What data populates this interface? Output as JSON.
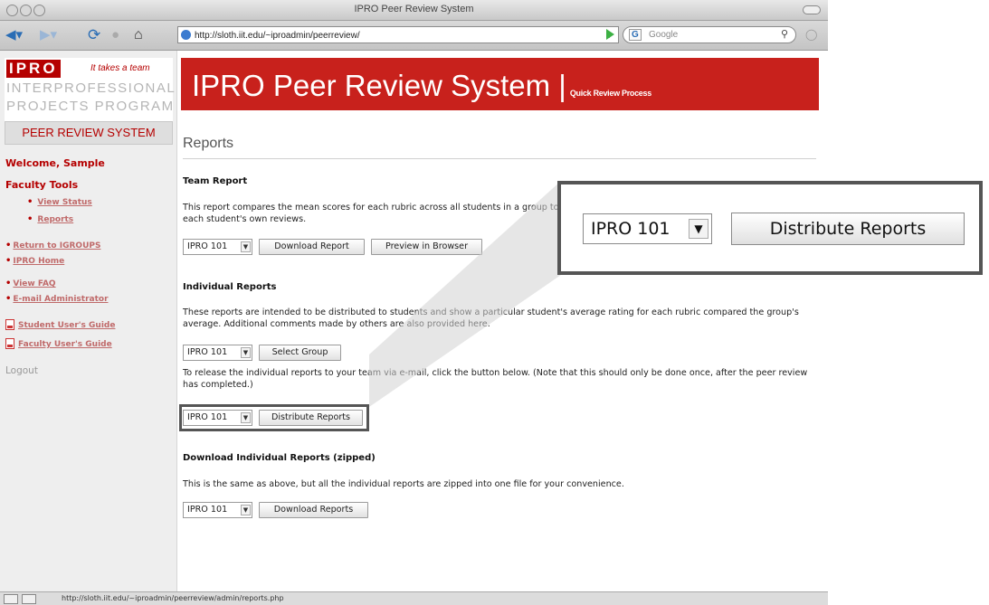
{
  "window": {
    "title": "IPRO Peer Review System",
    "url": "http://sloth.iit.edu/~iproadmin/peerreview/",
    "search_placeholder": "Google",
    "search_badge": "G"
  },
  "sidebar": {
    "logo_ipro": "IPRO",
    "logo_tagline": "It takes a team",
    "logo_line1": "INTERPROFESSIONAL",
    "logo_line2": "PROJECTS PROGRAM",
    "banner": "PEER REVIEW SYSTEM",
    "welcome": "Welcome, Sample",
    "faculty_tools": "Faculty Tools",
    "tools": [
      {
        "label": "View Status"
      },
      {
        "label": "Reports"
      }
    ],
    "links": [
      {
        "label": "Return to IGROUPS"
      },
      {
        "label": "IPRO Home"
      },
      {
        "label": "View FAQ"
      },
      {
        "label": "E-mail Administrator"
      }
    ],
    "guides": [
      {
        "label": "Student User's Guide"
      },
      {
        "label": "Faculty User's Guide"
      }
    ],
    "logout": "Logout"
  },
  "header": {
    "title": "IPRO Peer Review System |",
    "subtitle": "Quick Review Process"
  },
  "main": {
    "section_title": "Reports",
    "team_report": {
      "heading": "Team Report",
      "text": "This report compares the mean scores for each rubric across all students in a group to each student's own reviews.",
      "select_value": "IPRO 101",
      "download_label": "Download Report",
      "preview_label": "Preview in Browser"
    },
    "individual_reports": {
      "heading": "Individual Reports",
      "text": "These reports are intended to be distributed to students and show a particular student's average rating for each rubric compared the group's average. Additional comments made by others are also provided here.",
      "select_value": "IPRO 101",
      "select_group_label": "Select Group",
      "release_text": "To release the individual reports to your team via e-mail, click the button below. (Note that this should only be done once, after the peer review has completed.)",
      "distribute_select_value": "IPRO 101",
      "distribute_label": "Distribute Reports"
    },
    "zipped": {
      "heading": "Download Individual Reports (zipped)",
      "text": "This is the same as above, but all the individual reports are zipped into one file for your convenience.",
      "select_value": "IPRO 101",
      "download_label": "Download Reports"
    }
  },
  "status_bar": {
    "url": "http://sloth.iit.edu/~iproadmin/peerreview/admin/reports.php"
  },
  "callout": {
    "select_value": "IPRO 101",
    "button_label": "Distribute Reports"
  },
  "colors": {
    "brand_red": "#c8211c",
    "sidebar_bg": "#eeeeee",
    "highlight_border": "#555555"
  },
  "icons": {
    "pdf": "pdf-icon",
    "dropdown": "dropdown-arrow-icon"
  }
}
